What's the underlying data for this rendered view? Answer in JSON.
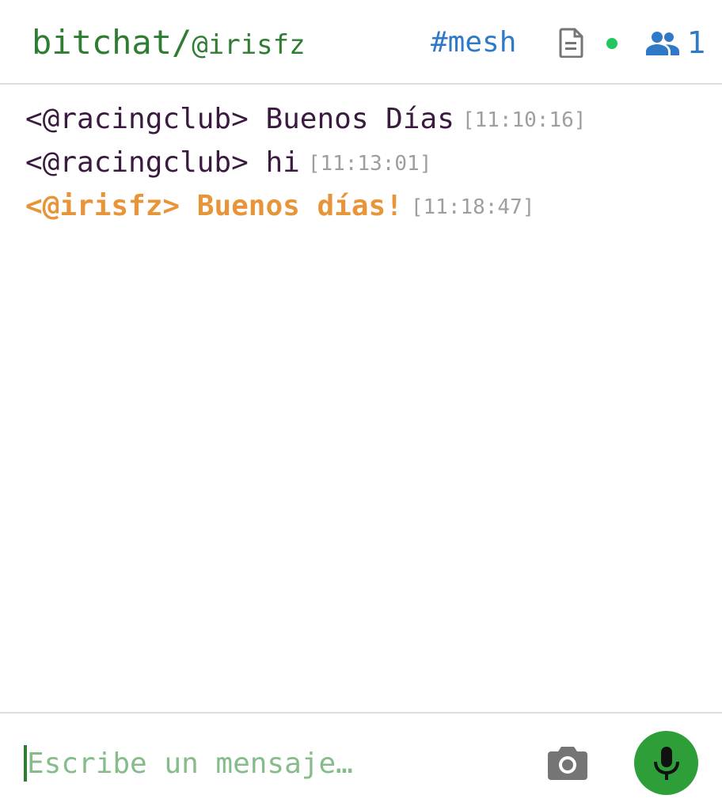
{
  "header": {
    "app_name": "bitchat/",
    "nickname": "@irisfz",
    "channel": "#mesh",
    "peer_count": "1",
    "status_color": "#22c55e",
    "icons": [
      "document-icon",
      "online-status-dot",
      "people-icon"
    ]
  },
  "messages": [
    {
      "sender": "<@racingclub>",
      "text": "Buenos Días",
      "timestamp": "[11:10:16]",
      "self": false
    },
    {
      "sender": "<@racingclub>",
      "text": "hi",
      "timestamp": "[11:13:01]",
      "self": false
    },
    {
      "sender": "<@irisfz>",
      "text": "Buenos días!",
      "timestamp": "[11:18:47]",
      "self": true
    }
  ],
  "composer": {
    "placeholder": "Escribe un mensaje…",
    "value": "",
    "icons": [
      "camera-icon",
      "microphone-icon"
    ]
  },
  "colors": {
    "brand_green": "#2e7d32",
    "channel_blue": "#2f7ac7",
    "self_message_orange": "#e8953a",
    "message_text": "#3b1a40",
    "timestamp_gray": "#9e9e9e",
    "mic_button_green": "#2e9e38"
  }
}
